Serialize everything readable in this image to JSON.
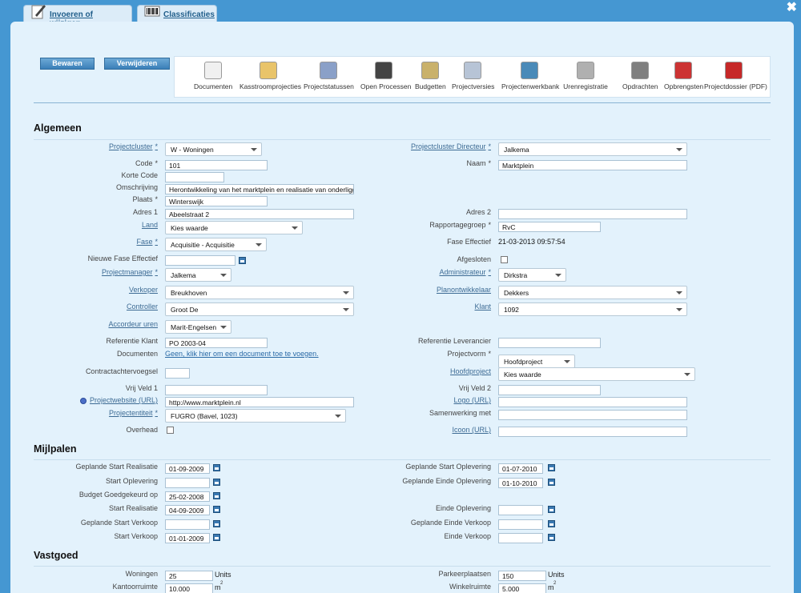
{
  "tabs": [
    {
      "label": "Invoeren of wijzigen",
      "icon": "pen-paper-icon"
    },
    {
      "label": "Classificaties",
      "icon": "barcode-icon"
    }
  ],
  "close_symbol": "✖",
  "buttons": {
    "save": "Bewaren",
    "delete": "Verwijderen"
  },
  "toolbar": [
    "Documenten",
    "Kasstroomprojecties",
    "Projectstatussen",
    "Open Processen",
    "Budgetten",
    "Projectversies",
    "Projectenwerkbank",
    "Urenregistratie",
    "Opdrachten",
    "Opbrengsten",
    "Projectdossier (PDF)"
  ],
  "toolbar_colors": [
    "#f0f0f0",
    "#e9c46a",
    "#8aa0c8",
    "#444444",
    "#c9b16b",
    "#b7c4d6",
    "#4a8ab8",
    "#b0b0b0",
    "#7f7f7f",
    "#cc3333",
    "#c62828"
  ],
  "sections": {
    "algemeen": "Algemeen",
    "mijlpalen": "Mijlpalen",
    "vastgoed": "Vastgoed"
  },
  "left": {
    "projectcluster": {
      "label": "Projectcluster",
      "req": "*",
      "value": "W - Woningen"
    },
    "code": {
      "label": "Code",
      "req": "*",
      "value": "101"
    },
    "korte_code": {
      "label": "Korte Code",
      "value": ""
    },
    "omschrijving": {
      "label": "Omschrijving",
      "value": "Herontwikkeling van het marktplein en realisatie van onderliggende"
    },
    "plaats": {
      "label": "Plaats",
      "req": "*",
      "value": "Winterswijk"
    },
    "adres1": {
      "label": "Adres 1",
      "value": "Abeelstraat 2"
    },
    "land": {
      "label": "Land",
      "value": "Kies waarde"
    },
    "fase": {
      "label": "Fase",
      "req": "*",
      "value": "Acquisitie - Acquisitie"
    },
    "nieuwe_fase": {
      "label": "Nieuwe Fase Effectief",
      "value": ""
    },
    "projectmanager": {
      "label": "Projectmanager",
      "req": "*",
      "value": "Jalkema"
    },
    "verkoper": {
      "label": "Verkoper",
      "value": "Breukhoven"
    },
    "controller": {
      "label": "Controller",
      "value": "Groot De"
    },
    "accordeur": {
      "label": "Accordeur uren",
      "value": "Marit-Engelsen"
    },
    "referentie_klant": {
      "label": "Referentie Klant",
      "value": "PO 2003-04"
    },
    "documenten": {
      "label": "Documenten",
      "value": "Geen, klik hier om een document toe te voegen."
    },
    "contractachtervoegsel": {
      "label": "Contractachtervoegsel",
      "value": ""
    },
    "vrij1": {
      "label": "Vrij Veld 1",
      "value": ""
    },
    "website": {
      "label": "Projectwebsite (URL)",
      "value": "http://www.marktplein.nl"
    },
    "projectentiteit": {
      "label": "Projectentiteit",
      "req": "*",
      "value": "FUGRO (Bavel, 1023)"
    },
    "overhead": {
      "label": "Overhead",
      "checked": false
    }
  },
  "right": {
    "directeur": {
      "label": "Projectcluster Directeur",
      "req": "*",
      "value": "Jalkema"
    },
    "naam": {
      "label": "Naam",
      "req": "*",
      "value": "Marktplein"
    },
    "adres2": {
      "label": "Adres 2",
      "value": ""
    },
    "rapportagegroep": {
      "label": "Rapportagegroep",
      "req": "*",
      "value": "RvC"
    },
    "fase_effectief": {
      "label": "Fase Effectief",
      "value": "21-03-2013 09:57:54"
    },
    "afgesloten": {
      "label": "Afgesloten",
      "checked": false
    },
    "administrateur": {
      "label": "Administrateur",
      "req": "*",
      "value": "Dirkstra"
    },
    "planontwikkelaar": {
      "label": "Planontwikkelaar",
      "value": "Dekkers"
    },
    "klant": {
      "label": "Klant",
      "value": "1092"
    },
    "referentie_leverancier": {
      "label": "Referentie Leverancier",
      "value": ""
    },
    "projectvorm": {
      "label": "Projectvorm",
      "req": "*",
      "value": "Hoofdproject"
    },
    "hoofdproject": {
      "label": "Hoofdproject",
      "value": "Kies waarde"
    },
    "vrij2": {
      "label": "Vrij Veld 2",
      "value": ""
    },
    "logo": {
      "label": "Logo (URL)",
      "value": ""
    },
    "samenwerking": {
      "label": "Samenwerking met",
      "value": ""
    },
    "icoon": {
      "label": "Icoon (URL)",
      "value": ""
    }
  },
  "mijlpalen_left": [
    {
      "label": "Geplande Start Realisatie",
      "value": "01-09-2009"
    },
    {
      "label": "Start Oplevering",
      "value": ""
    },
    {
      "label": "Budget Goedgekeurd op",
      "value": "25-02-2008"
    },
    {
      "label": "Start Realisatie",
      "value": "04-09-2009"
    },
    {
      "label": "Geplande Start Verkoop",
      "value": ""
    },
    {
      "label": "Start Verkoop",
      "value": "01-01-2009"
    }
  ],
  "mijlpalen_right": [
    {
      "label": "Geplande Start Oplevering",
      "value": "01-07-2010"
    },
    {
      "label": "Geplande Einde Oplevering",
      "value": "01-10-2010"
    },
    {
      "label": "Einde Oplevering",
      "value": ""
    },
    {
      "label": "Geplande Einde Verkoop",
      "value": ""
    },
    {
      "label": "Einde Verkoop",
      "value": ""
    }
  ],
  "vastgoed": {
    "woningen": {
      "label": "Woningen",
      "value": "25",
      "unit": "Units"
    },
    "kantoorruimte": {
      "label": "Kantoorruimte",
      "value": "10.000",
      "unit": "m",
      "sup": "2"
    },
    "parkeerplaatsen": {
      "label": "Parkeerplaatsen",
      "value": "150",
      "unit": "Units"
    },
    "winkelruimte": {
      "label": "Winkelruimte",
      "value": "5.000",
      "unit": "m",
      "sup": "2"
    }
  }
}
